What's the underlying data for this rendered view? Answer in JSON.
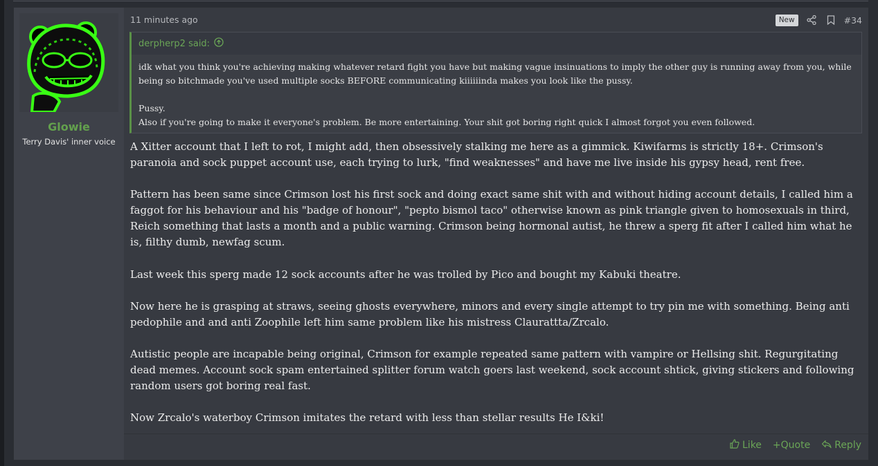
{
  "post": {
    "time": "11 minutes ago",
    "new_badge": "New",
    "number": "#34",
    "icons": {
      "share": "share-icon",
      "bookmark": "bookmark-icon"
    }
  },
  "user": {
    "name": "Glowie",
    "title": "Terry Davis' inner voice",
    "name_color": "#63a04d"
  },
  "quote": {
    "author": "derpherp2 said:",
    "paragraphs": [
      "idk what you think you're achieving making whatever retard fight you have but making vague insinuations to imply the other guy is running away from you, while being so bitchmade you've used multiple socks BEFORE communicating kiiiiiinda makes you look like the pussy.",
      "Pussy.",
      "Also if you're going to make it everyone's problem. Be more entertaining. Your shit got boring right quick I almost forgot you even followed."
    ]
  },
  "body": {
    "paragraphs": [
      "A Xitter account that I left to rot, I might add, then obsessively stalking me here as a gimmick. Kiwifarms is strictly 18+. Crimson's paranoia and sock puppet account use, each trying to lurk, \"find weaknesses\" and have me live inside his gypsy head, rent free.",
      "Pattern has been same since Crimson lost his first sock and doing exact same shit with and without hiding account details, I called him a faggot for his behaviour and his \"badge of honour\", \"pepto bismol taco\" otherwise known as pink triangle given to homosexuals in third, Reich something that lasts a month and a public warning. Crimson being hormonal autist, he threw a sperg fit after I called him what he is, filthy dumb, newfag scum.",
      "Last week this sperg made 12 sock accounts after he was trolled by Pico and bought my Kabuki theatre.",
      "Now here he is grasping at straws, seeing ghosts everywhere, minors and every single attempt to try pin me with something. Being anti pedophile and and anti Zoophile left him same problem like his mistress Claurattta/Zrcalo.",
      "Autistic people are incapable being original, Crimson for example repeated same pattern with vampire or Hellsing shit. Regurgitating dead memes. Account sock spam entertained splitter forum watch goers last weekend, sock account shtick, giving stickers and following random users got boring real fast.",
      "Now Zrcalo's waterboy Crimson imitates the retard with less than stellar results He I&ki!"
    ]
  },
  "actions": {
    "like": "Like",
    "quote": "+Quote",
    "reply": "Reply"
  },
  "colors": {
    "accent": "#63a04d",
    "post_bg": "#373a41",
    "user_bg": "#3e4149"
  }
}
